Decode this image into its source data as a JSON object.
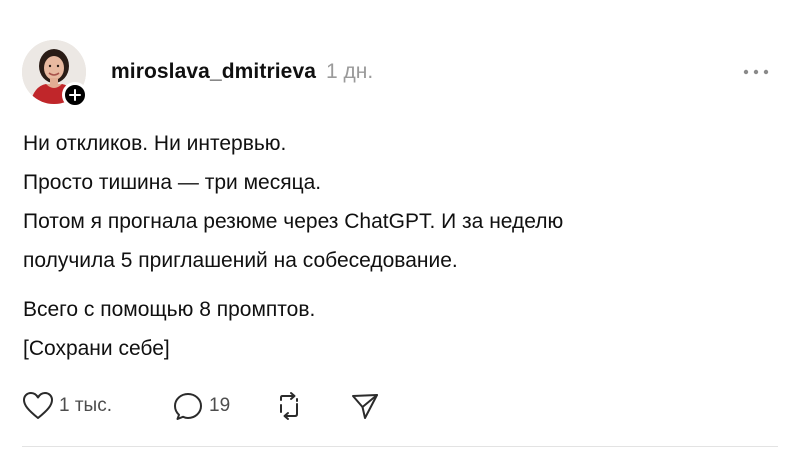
{
  "post": {
    "author": {
      "username": "miroslava_dmitrieva",
      "timestamp": "1 дн."
    },
    "body": {
      "paragraph1": [
        "Ни откликов. Ни интервью.",
        "Просто тишина — три месяца.",
        "Потом я прогнала резюме через ChatGPT. И за неделю",
        "получила 5 приглашений на собеседование."
      ],
      "paragraph2": [
        "Всего с помощью 8 промптов.",
        "[Сохрани себе]"
      ]
    },
    "actions": {
      "likes": "1 тыс.",
      "replies": "19"
    }
  },
  "icons": {
    "follow": "plus-icon",
    "more": "more-horizontal-icon",
    "like": "heart-icon",
    "reply": "comment-bubble-icon",
    "repost": "repost-icon",
    "share": "send-icon"
  },
  "colors": {
    "text": "#101010",
    "muted": "#9a9a9a",
    "count": "#4d4d4d",
    "divider": "#e3e3e3",
    "avatar_top": "#c0262a"
  }
}
